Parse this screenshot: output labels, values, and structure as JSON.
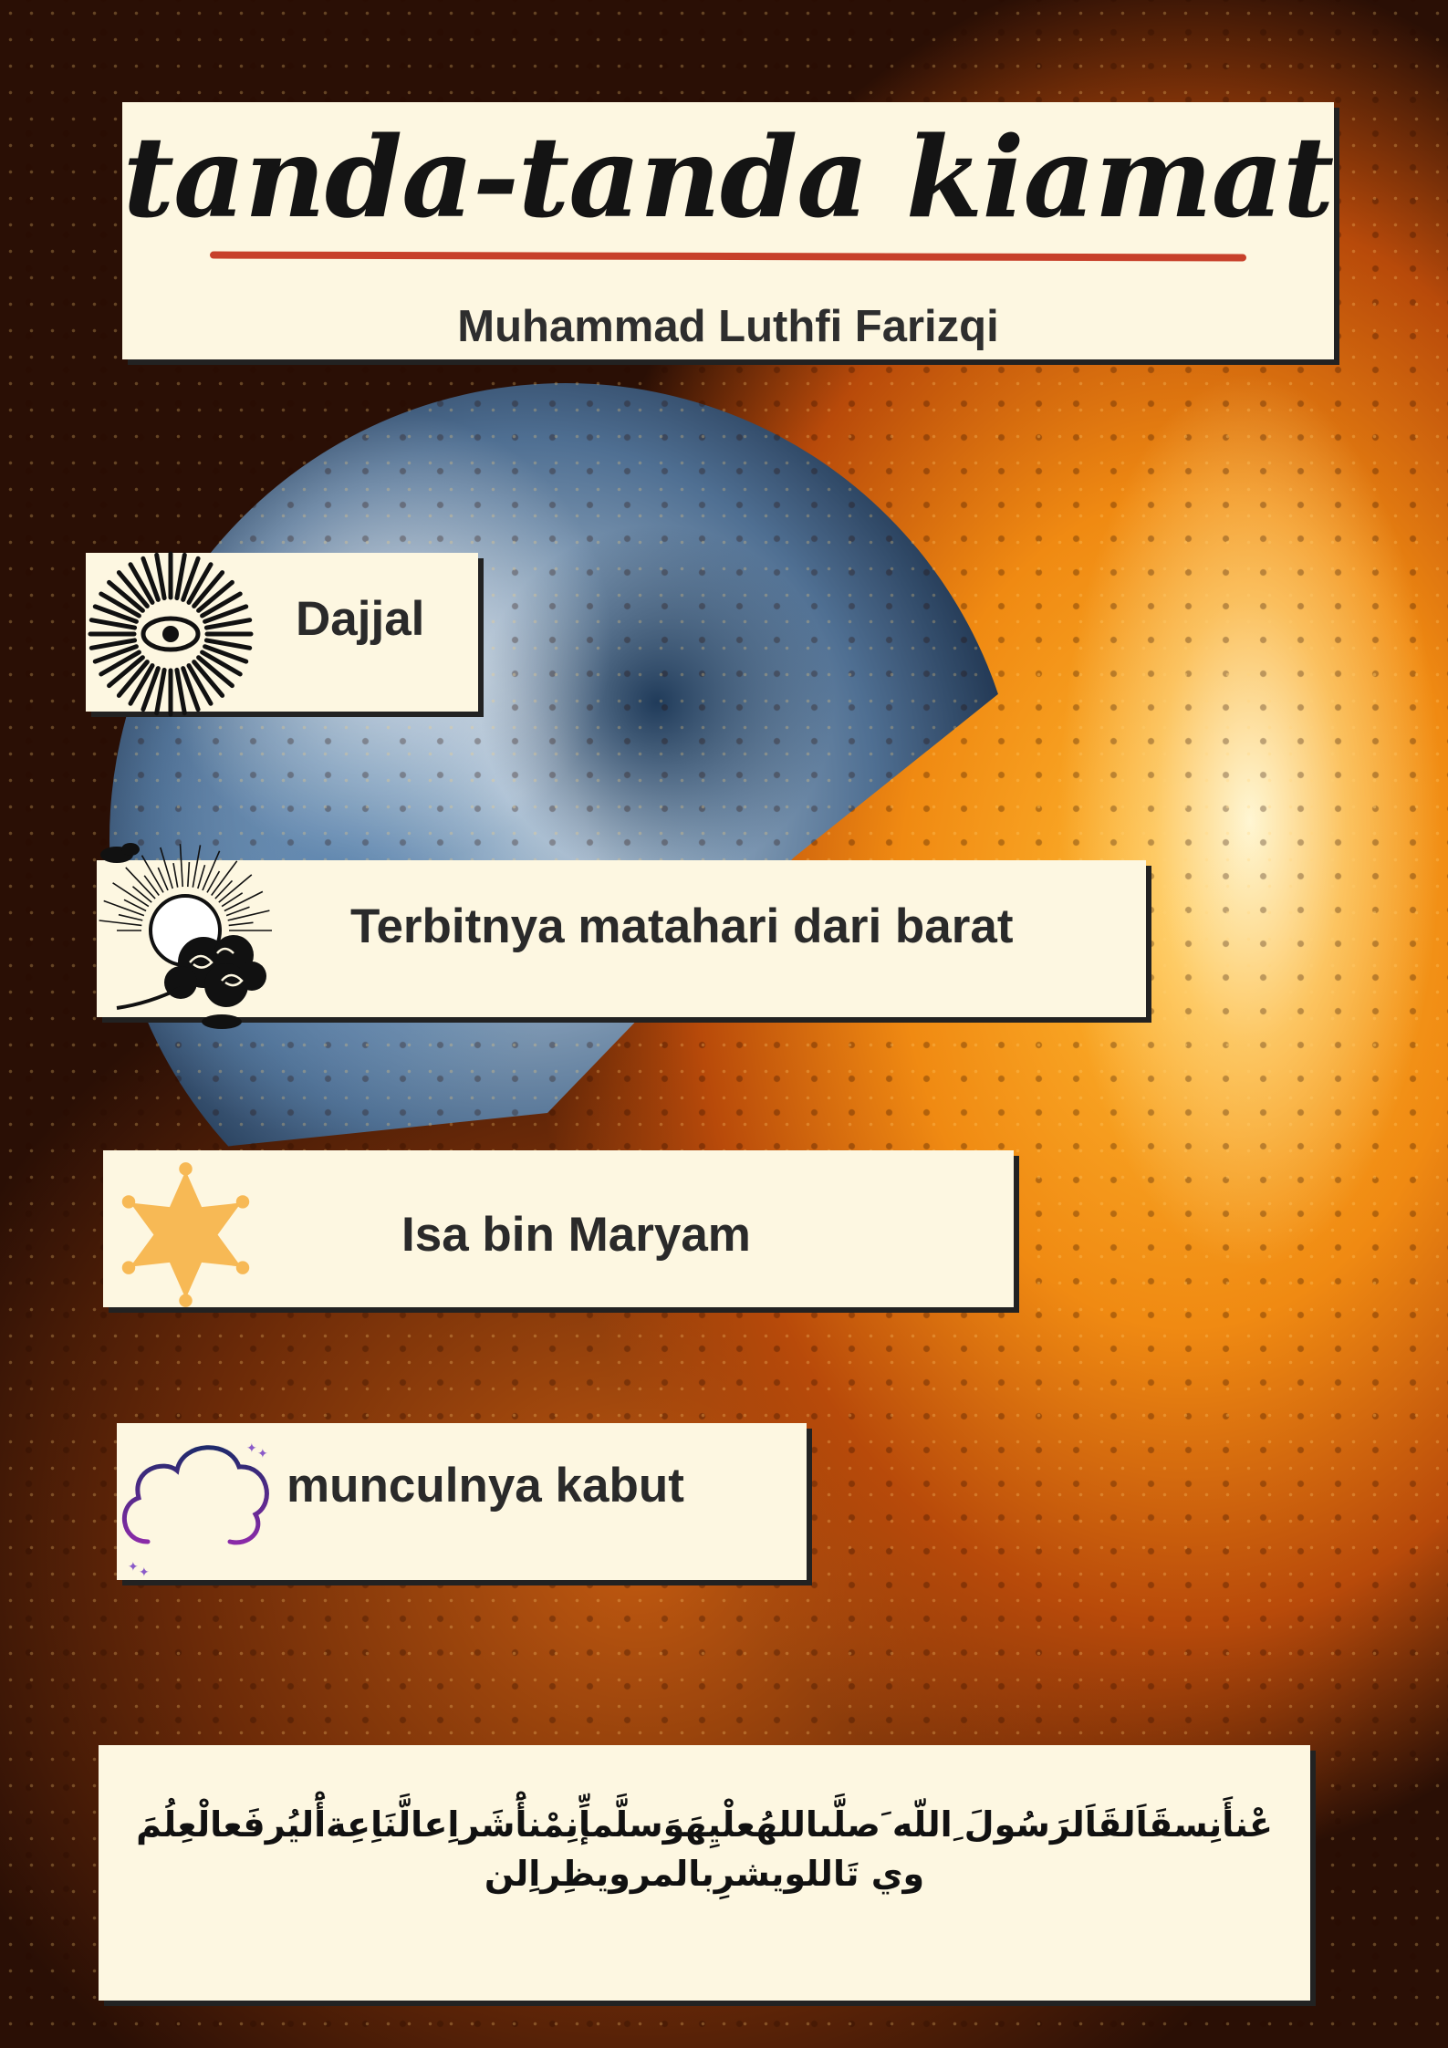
{
  "title": "tanda-tanda kiamat",
  "author": "Muhammad Luthfi Farizqi",
  "items": [
    {
      "label": "Dajjal",
      "icon": "eye-rays-icon"
    },
    {
      "label": "Terbitnya matahari dari barat",
      "icon": "sun-clouds-icon"
    },
    {
      "label": "Isa bin Maryam",
      "icon": "star-badge-icon"
    },
    {
      "label": "munculnya kabut",
      "icon": "cloud-rain-icon"
    }
  ],
  "hadith": {
    "line1": "عْنأَنِسقَاَلقَاَلرَسُولَ ِاللّه َصلَّىاللهُعلْيِهَوَسلَّمإِّنِمْنأَْشَراِعالَّنَاِعِةأَْليُرفَعالْعِلُمَ",
    "line2": "وي تَاللويشرِبالمرويظِراِلن"
  },
  "colors": {
    "card": "#fdf7e1",
    "underline": "#c7402a",
    "star": "#f7b955",
    "cloud_outline": "#4a2c7a"
  }
}
